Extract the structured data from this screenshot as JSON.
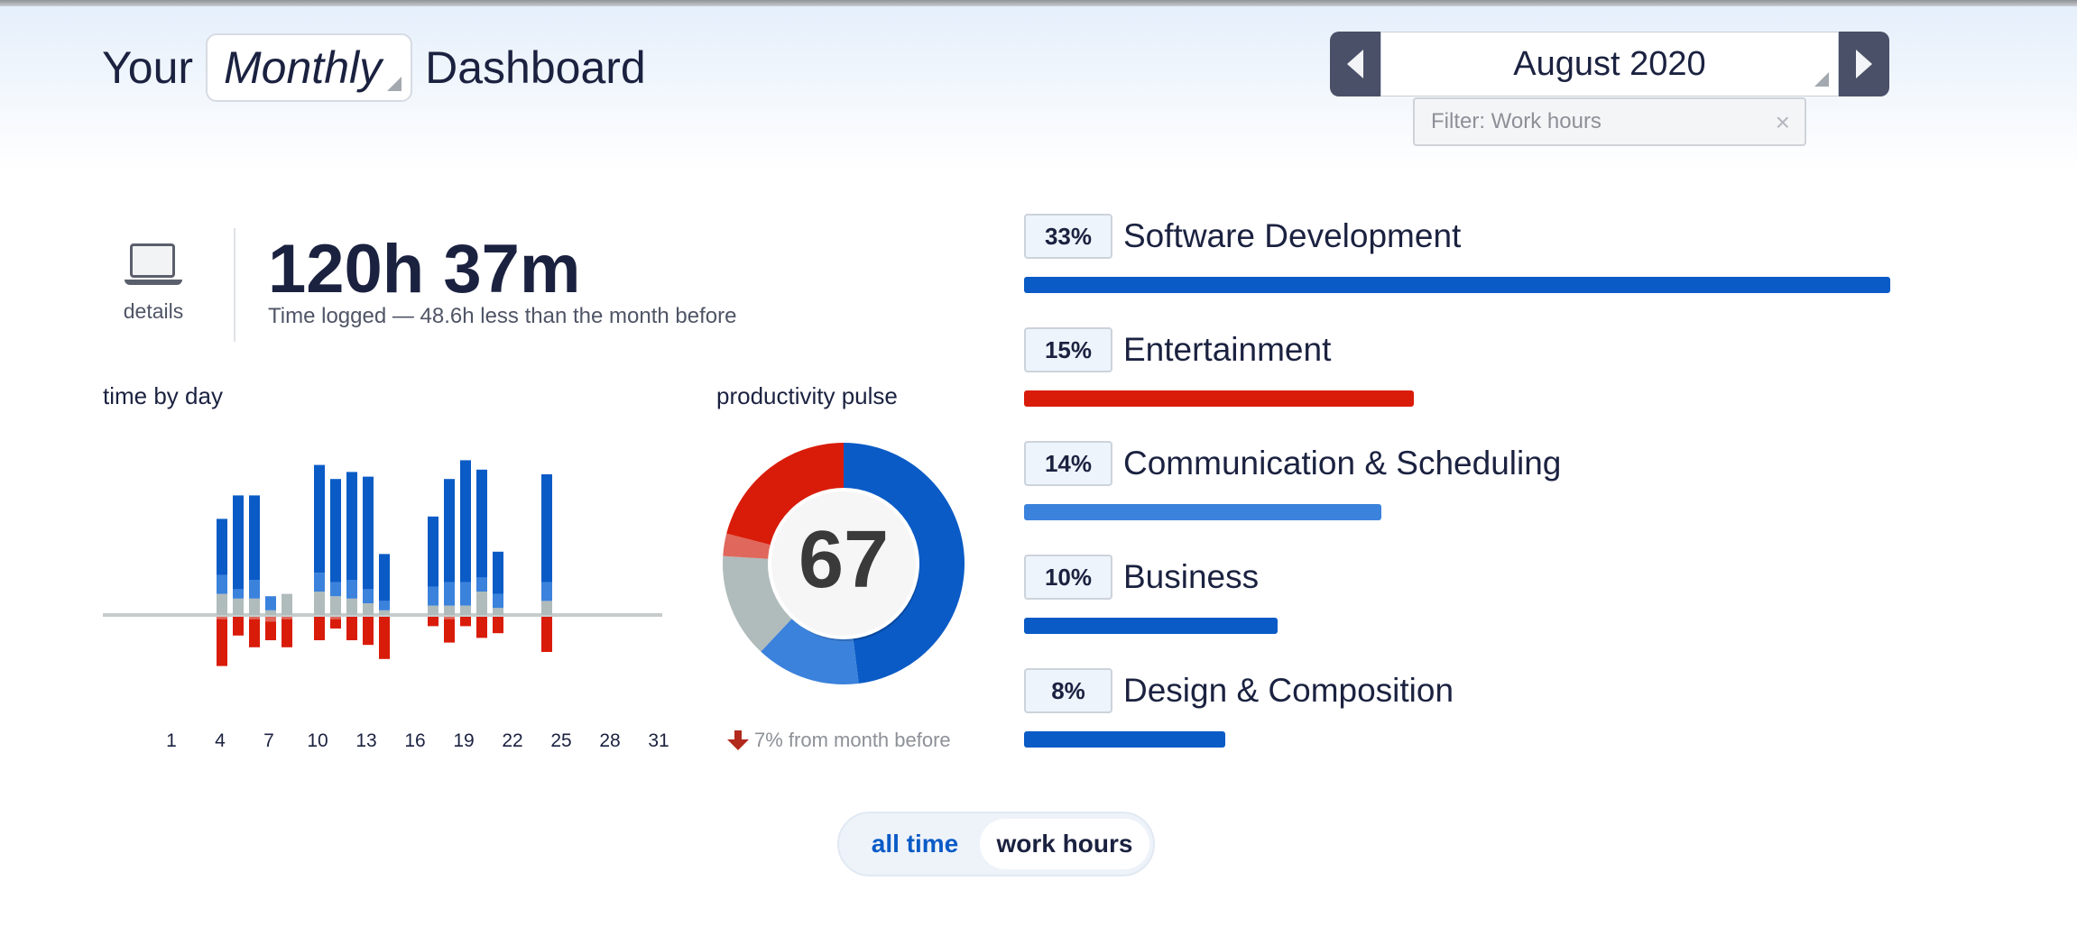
{
  "header": {
    "title_prefix": "Your",
    "period": "Monthly",
    "title_suffix": "Dashboard",
    "month": "August 2020",
    "filter": "Filter: Work hours",
    "filter_clear": "×"
  },
  "summary": {
    "details_label": "details",
    "total": "120h 37m",
    "subtitle": "Time logged — 48.6h less than the month before"
  },
  "time_by_day": {
    "title": "time by day",
    "tick_labels": [
      "1",
      "4",
      "7",
      "10",
      "13",
      "16",
      "19",
      "22",
      "25",
      "28",
      "31"
    ]
  },
  "pulse": {
    "title": "productivity pulse",
    "score": "67",
    "change": "7% from month before"
  },
  "categories": [
    {
      "pct": "33%",
      "name": "Software Development",
      "share": 1.0,
      "color": "#0a5bc6"
    },
    {
      "pct": "15%",
      "name": "Entertainment",
      "share": 0.45,
      "color": "#d91c0a"
    },
    {
      "pct": "14%",
      "name": "Communication & Scheduling",
      "share": 0.413,
      "color": "#3b82dc"
    },
    {
      "pct": "10%",
      "name": "Business",
      "share": 0.293,
      "color": "#0a5bc6"
    },
    {
      "pct": "8%",
      "name": "Design & Composition",
      "share": 0.232,
      "color": "#0a5bc6"
    }
  ],
  "toggle": {
    "all_time": "all time",
    "work_hours": "work hours"
  },
  "colors": {
    "very_productive": "#0a5bc6",
    "productive": "#3b82dc",
    "neutral": "#b0bbbb",
    "distracting": "#e0675b",
    "very_distracting": "#d91c0a"
  },
  "chart_data": [
    {
      "type": "bar",
      "title": "time by day",
      "x": [
        1,
        2,
        3,
        4,
        5,
        6,
        7,
        8,
        9,
        10,
        11,
        12,
        13,
        14,
        15,
        16,
        17,
        18,
        19,
        20,
        21,
        22,
        23,
        24,
        25,
        26,
        27,
        28,
        29,
        30,
        31
      ],
      "x_tick_labels": [
        "1",
        "4",
        "7",
        "10",
        "13",
        "16",
        "19",
        "22",
        "25",
        "28",
        "31"
      ],
      "series": [
        {
          "values": [
            0,
            0,
            0,
            1.2,
            2.0,
            1.8,
            0,
            0,
            0,
            2.3,
            2.2,
            2.3,
            2.4,
            1.0,
            0,
            0,
            1.5,
            2.2,
            2.6,
            2.3,
            0.9,
            0,
            0,
            2.3,
            0,
            0,
            0,
            0,
            0,
            0,
            0
          ]
        },
        {
          "values": [
            0,
            0,
            0,
            0.4,
            0.2,
            0.4,
            0.3,
            0,
            0,
            0.4,
            0.3,
            0.4,
            0.3,
            0.2,
            0,
            0,
            0.4,
            0.5,
            0.5,
            0.3,
            0.3,
            0,
            0,
            0.4,
            0,
            0,
            0,
            0,
            0,
            0,
            0
          ]
        },
        {
          "values": [
            0,
            0,
            0,
            0.45,
            0.35,
            0.35,
            0.1,
            0.45,
            0,
            0.5,
            0.4,
            0.35,
            0.25,
            0.1,
            0,
            0,
            0.2,
            0.2,
            0.2,
            0.5,
            0.15,
            0,
            0,
            0.3,
            0,
            0,
            0,
            0,
            0,
            0,
            0
          ]
        },
        {
          "values": [
            0,
            0,
            0,
            -0.05,
            0,
            -0.05,
            -0.1,
            -0.05,
            0,
            0,
            -0.05,
            0,
            0,
            0,
            0,
            0,
            0,
            -0.05,
            0,
            0,
            0,
            0,
            0,
            0,
            0,
            0,
            0,
            0,
            0,
            0,
            0
          ]
        },
        {
          "values": [
            0,
            0,
            0,
            -1.0,
            -0.4,
            -0.6,
            -0.4,
            -0.6,
            0,
            -0.5,
            -0.2,
            -0.5,
            -0.6,
            -0.9,
            0,
            0,
            -0.2,
            -0.5,
            -0.2,
            -0.45,
            -0.35,
            0,
            0,
            -0.75,
            0,
            0,
            0,
            0,
            0,
            0,
            0
          ]
        }
      ]
    },
    {
      "type": "pie",
      "title": "productivity pulse",
      "center_label": "67",
      "slices": [
        {
          "value": 48,
          "color": "#0a5bc6"
        },
        {
          "value": 14,
          "color": "#3b82dc"
        },
        {
          "value": 14,
          "color": "#b0bbbb"
        },
        {
          "value": 3,
          "color": "#e0675b"
        },
        {
          "value": 21,
          "color": "#d91c0a"
        }
      ]
    },
    {
      "type": "bar",
      "orientation": "horizontal",
      "categories": [
        "Software Development",
        "Entertainment",
        "Communication & Scheduling",
        "Business",
        "Design & Composition"
      ],
      "values": [
        33,
        15,
        14,
        10,
        8
      ],
      "value_labels": [
        "33%",
        "15%",
        "14%",
        "10%",
        "8%"
      ]
    }
  ]
}
